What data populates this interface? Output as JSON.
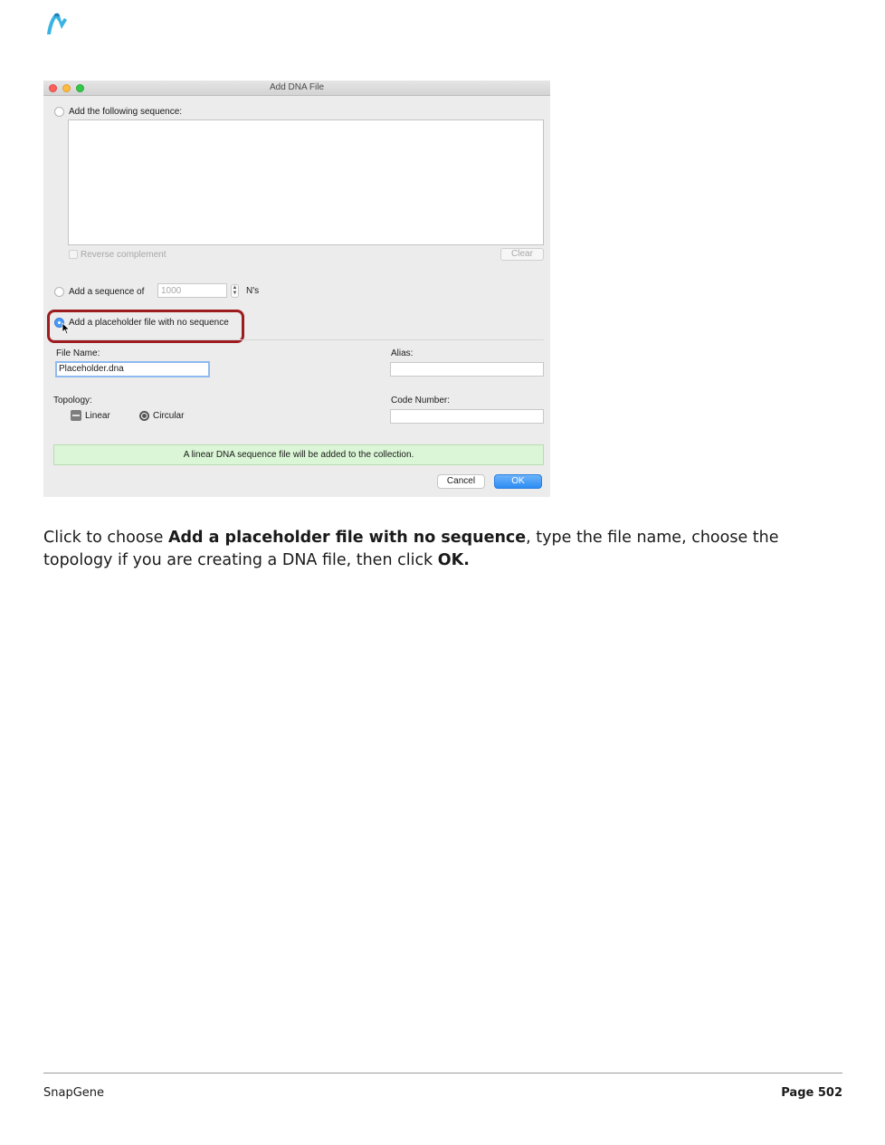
{
  "dialog": {
    "title": "Add DNA File",
    "option_sequence_label": "Add the following sequence:",
    "reverse_complement_label": "Reverse complement",
    "clear_label": "Clear",
    "option_length_label": "Add a sequence of",
    "length_value": "1000",
    "length_unit": "N's",
    "option_placeholder_label": "Add a placeholder file with no sequence",
    "file_name_label": "File Name:",
    "file_name_value": "Placeholder.dna",
    "alias_label": "Alias:",
    "alias_value": "",
    "topology_label": "Topology:",
    "linear_label": "Linear",
    "circular_label": "Circular",
    "code_number_label": "Code Number:",
    "code_number_value": "",
    "status_message": "A linear DNA sequence file will be added to the collection.",
    "cancel_label": "Cancel",
    "ok_label": "OK",
    "selected_option": "placeholder",
    "highlight_color": "#9c1c1f"
  },
  "caption": {
    "part1": "Click to choose ",
    "bold1": "Add a placeholder file with no sequence",
    "part2": ", type the file name, choose the topology if you are creating a DNA file, then click ",
    "bold2": "OK."
  },
  "footer": {
    "brand": "SnapGene",
    "page": "Page 502"
  },
  "icons": [
    "snapgene-logo-icon",
    "close-icon",
    "minimize-icon",
    "zoom-icon",
    "mouse-cursor-icon"
  ]
}
